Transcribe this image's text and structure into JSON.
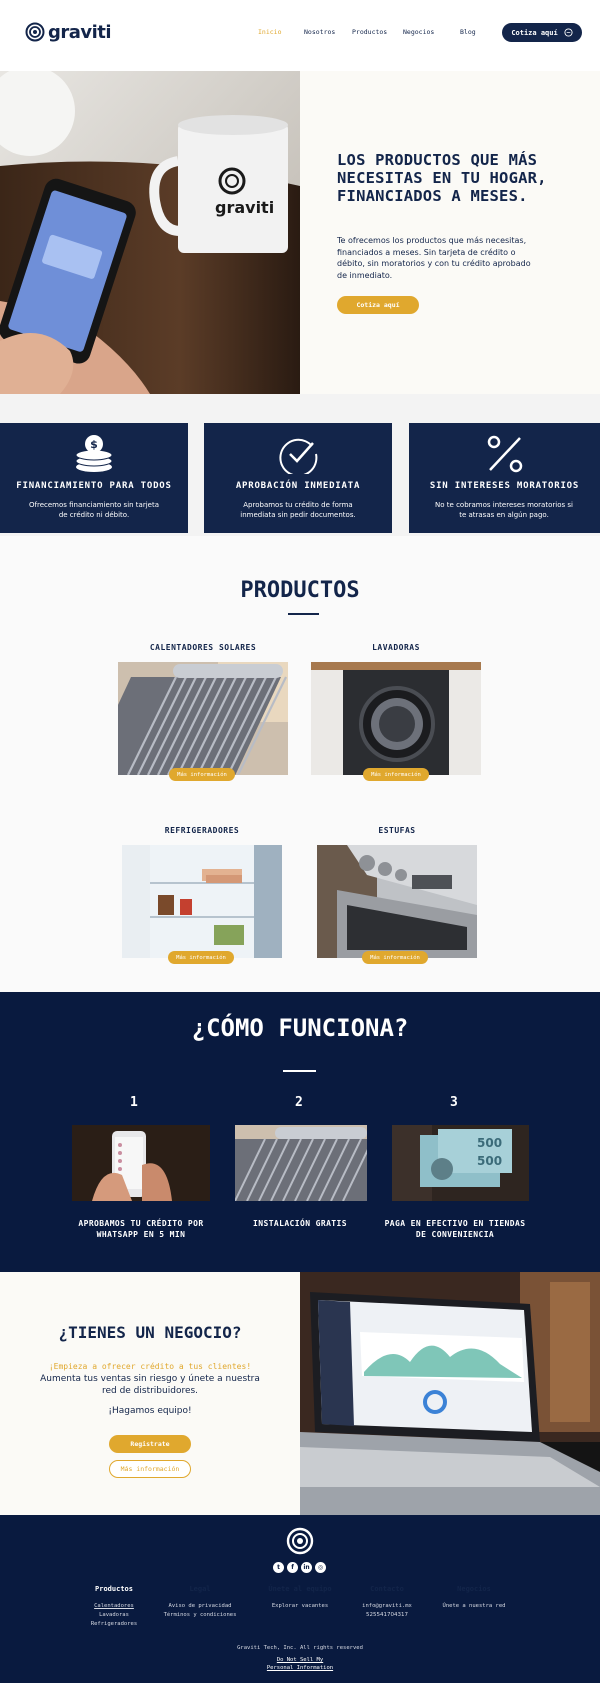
{
  "header": {
    "logo_text": "graviti",
    "nav": [
      "Inicio",
      "Nosotros",
      "Productos",
      "Negocios",
      "Blog"
    ],
    "cta": "Cotiza aquí"
  },
  "hero": {
    "title": "LOS PRODUCTOS QUE MÁS NECESITAS EN TU HOGAR, FINANCIADOS A MESES.",
    "text": "Te ofrecemos los productos que más necesitas, financiados a meses. Sin tarjeta de crédito o débito, sin moratorios y con tu crédito aprobado de inmediato.",
    "button": "Cotiza aquí",
    "mug_text": "graviti"
  },
  "features": [
    {
      "title": "FINANCIAMIENTO PARA TODOS",
      "desc": "Ofrecemos financiamiento sin tarjeta de crédito ni débito.",
      "icon": "money-stack-icon"
    },
    {
      "title": "APROBACIÓN INMEDIATA",
      "desc": "Aprobamos tu crédito de forma inmediata sin pedir documentos.",
      "icon": "check-circle-icon"
    },
    {
      "title": "SIN INTERESES MORATORIOS",
      "desc": "No te cobramos intereses moratorios si te atrasas en algún pago.",
      "icon": "percent-icon"
    }
  ],
  "products": {
    "title": "PRODUCTOS",
    "items": [
      {
        "name": "CALENTADORES SOLARES",
        "button": "Más información"
      },
      {
        "name": "LAVADORAS",
        "button": "Más información"
      },
      {
        "name": "REFRIGERADORES",
        "button": "Más información"
      },
      {
        "name": "ESTUFAS",
        "button": "Más información"
      }
    ]
  },
  "how": {
    "title": "¿CÓMO FUNCIONA?",
    "steps": [
      {
        "num": "1",
        "caption": "APROBAMOS TU CRÉDITO POR WHATSAPP EN 5 MIN"
      },
      {
        "num": "2",
        "caption": "INSTALACIÓN GRATIS"
      },
      {
        "num": "3",
        "caption": "PAGA EN EFECTIVO EN TIENDAS DE CONVENIENCIA"
      }
    ]
  },
  "negocio": {
    "title": "¿TIENES UN NEGOCIO?",
    "highlight": "¡Empieza a ofrecer crédito a tus clientes!",
    "text": "Aumenta tus ventas sin riesgo y únete a nuestra red de distribuidores.",
    "team": "¡Hagamos  equipo!",
    "register": "Registrate",
    "more": "Más información"
  },
  "footer": {
    "columns": [
      {
        "title": "Productos",
        "links": [
          "Calentadores",
          "Lavadoras",
          "Refrigeradores"
        ]
      },
      {
        "title": "Legal",
        "links": [
          "Aviso de privacidad",
          "Términos y condiciones"
        ]
      },
      {
        "title": "Únete al equipo",
        "links": [
          "Explorar vacantes"
        ]
      },
      {
        "title": "Contacto",
        "links": [
          "info@graviti.mx",
          "525541704317"
        ]
      },
      {
        "title": "Negocios",
        "links": [
          "Únete a nuestra red"
        ]
      }
    ],
    "copyright": "Graviti Tech, Inc. All rights reserved",
    "legal1": "Do Not Sell My",
    "legal2": "Personal Information",
    "social": [
      "twitter-icon",
      "facebook-icon",
      "linkedin-icon",
      "instagram-icon"
    ]
  },
  "colors": {
    "navy": "#13254a",
    "dark_navy": "#091a3f",
    "gold": "#e0a82e"
  }
}
